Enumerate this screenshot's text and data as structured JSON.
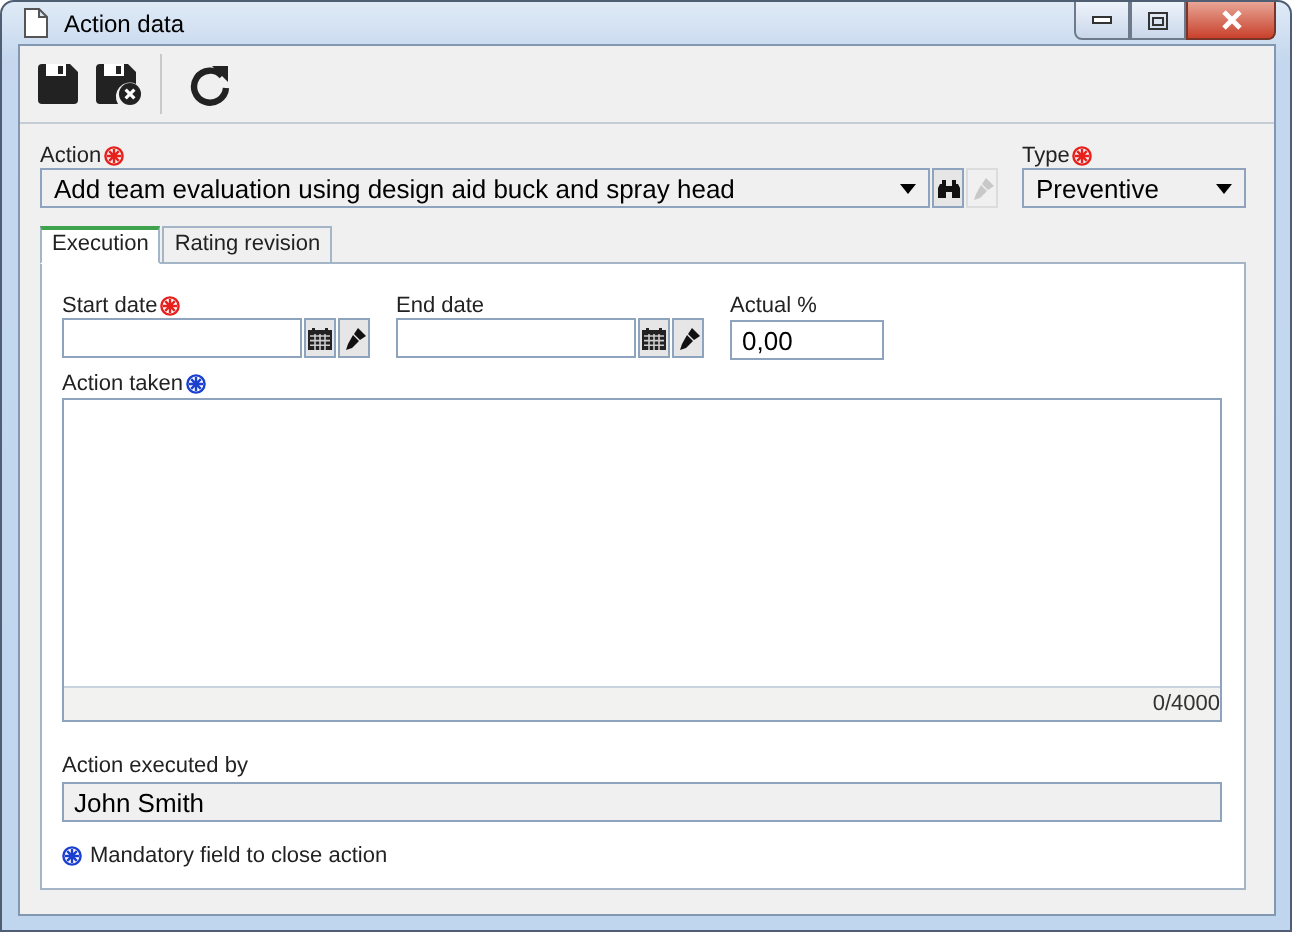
{
  "window": {
    "title": "Action data"
  },
  "toolbar": [
    {
      "kind": "save"
    },
    {
      "kind": "save_close"
    },
    {
      "kind": "separator"
    },
    {
      "kind": "refresh"
    }
  ],
  "action": {
    "label": "Action",
    "required": true,
    "value": "Add team evaluation using design aid buck and spray head",
    "clear_disabled": true
  },
  "type": {
    "label": "Type",
    "required": true,
    "value": "Preventive"
  },
  "tabs": [
    {
      "label": "Execution",
      "selected": true
    },
    {
      "label": "Rating revision",
      "selected": false
    }
  ],
  "dates": [
    {
      "label": "Start date",
      "required": true
    },
    {
      "label": "End date",
      "required": false
    }
  ],
  "actual": {
    "label": "Actual %",
    "value": "0,00"
  },
  "action_taken": {
    "label": "Action taken",
    "required_to_close": true,
    "counter": "0/4000"
  },
  "executed_by": {
    "label": "Action executed by",
    "value": "John Smith",
    "disabled": true
  },
  "legend": {
    "text": "Mandatory field to close action"
  }
}
